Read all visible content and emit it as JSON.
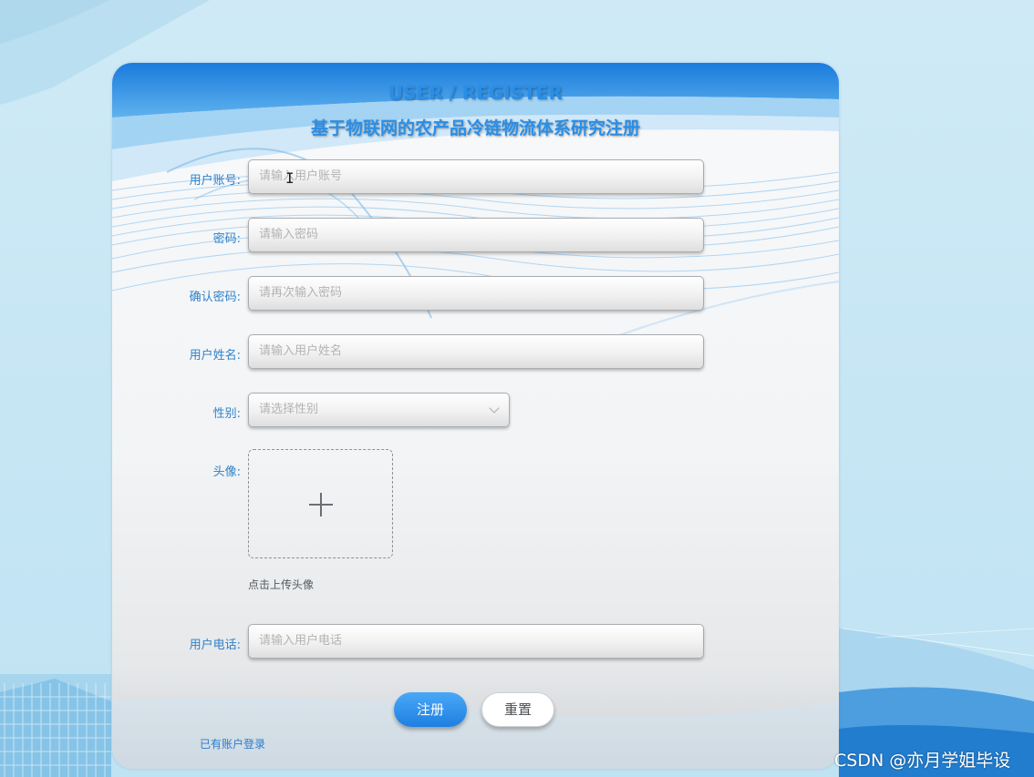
{
  "header": {
    "title_en": "USER / REGISTER",
    "title_cn": "基于物联网的农产品冷链物流体系研究注册"
  },
  "form": {
    "account": {
      "label": "用户账号:",
      "placeholder": "请输入用户账号"
    },
    "password": {
      "label": "密码:",
      "placeholder": "请输入密码"
    },
    "confirm_password": {
      "label": "确认密码:",
      "placeholder": "请再次输入密码"
    },
    "name": {
      "label": "用户姓名:",
      "placeholder": "请输入用户姓名"
    },
    "gender": {
      "label": "性别:",
      "placeholder": "请选择性别"
    },
    "avatar": {
      "label": "头像:",
      "hint": "点击上传头像"
    },
    "phone": {
      "label": "用户电话:",
      "placeholder": "请输入用户电话"
    }
  },
  "actions": {
    "register": "注册",
    "reset": "重置",
    "login_link": "已有账户登录"
  },
  "watermark": "CSDN @亦月学姐毕设",
  "icons": {
    "gender_dropdown": "chevron-down-icon",
    "avatar_upload": "plus-icon",
    "cursor": "text-cursor-icon"
  },
  "colors": {
    "accent": "#2a8ee6",
    "label": "#2f80c8",
    "primary_button": "#1e7fe0"
  }
}
